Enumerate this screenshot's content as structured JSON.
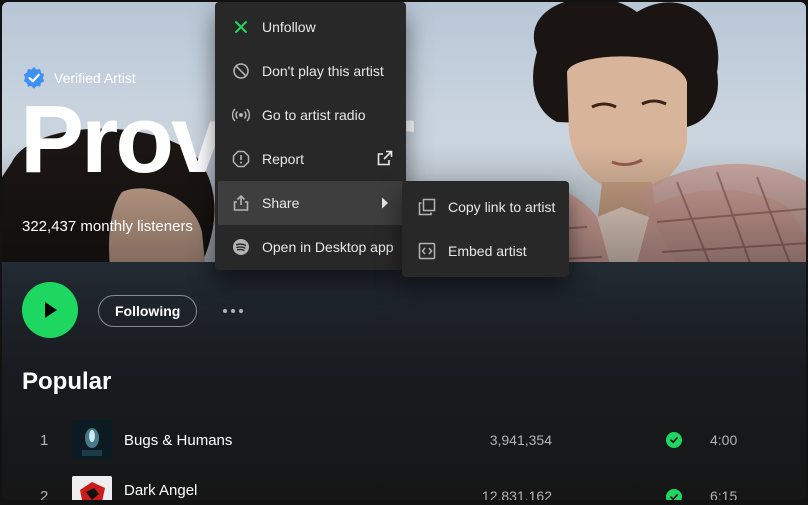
{
  "colors": {
    "accent": "#1ed760",
    "menu_bg": "#282828",
    "menu_hover": "#3e3e3e",
    "verified": "#3d91f4"
  },
  "artist": {
    "verified_label": "Verified Artist",
    "name": "Provoker",
    "monthly_listeners": "322,437 monthly listeners"
  },
  "actions": {
    "following_label": "Following"
  },
  "popular_heading": "Popular",
  "tracks": [
    {
      "num": "1",
      "title": "Bugs & Humans",
      "plays": "3,941,354",
      "duration": "4:00",
      "liked": true
    },
    {
      "num": "2",
      "title": "Dark Angel",
      "plays": "12,831,162",
      "duration": "6:15",
      "liked": true
    }
  ],
  "context_menu": {
    "items": [
      {
        "label": "Unfollow",
        "icon": "close-icon"
      },
      {
        "label": "Don't play this artist",
        "icon": "block-icon"
      },
      {
        "label": "Go to artist radio",
        "icon": "radio-icon"
      },
      {
        "label": "Report",
        "icon": "report-icon"
      },
      {
        "label": "Share",
        "icon": "share-icon"
      },
      {
        "label": "Open in Desktop app",
        "icon": "spotify-icon"
      }
    ],
    "share_submenu": [
      {
        "label": "Copy link to artist",
        "icon": "copy-icon"
      },
      {
        "label": "Embed artist",
        "icon": "embed-icon"
      }
    ]
  }
}
